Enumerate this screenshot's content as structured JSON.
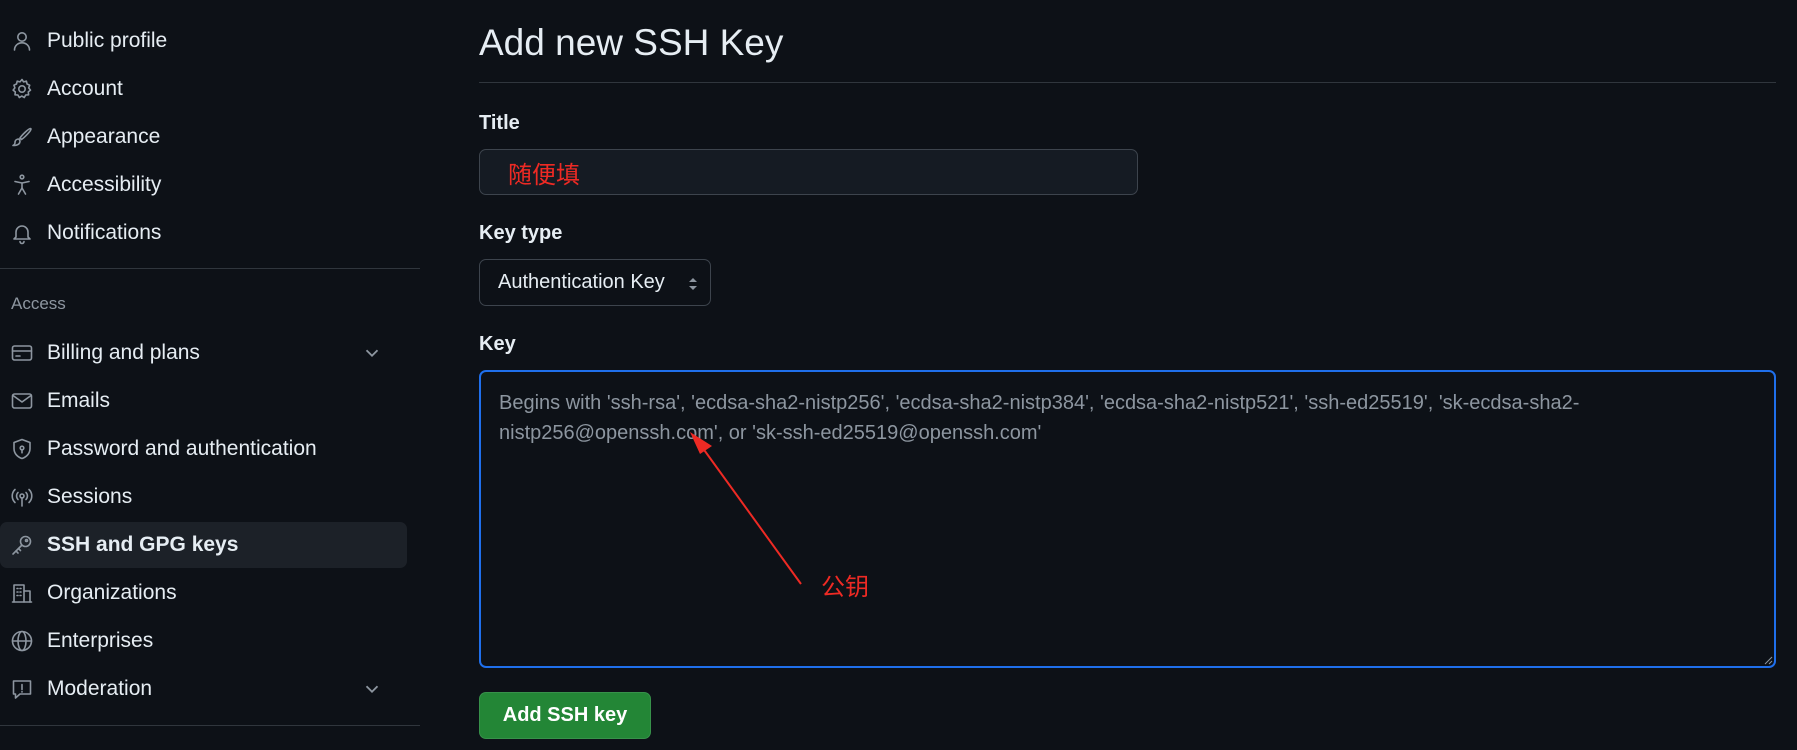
{
  "sidebar": {
    "items": [
      {
        "label": "Public profile",
        "icon": "person-icon"
      },
      {
        "label": "Account",
        "icon": "gear-icon"
      },
      {
        "label": "Appearance",
        "icon": "paintbrush-icon"
      },
      {
        "label": "Accessibility",
        "icon": "accessibility-icon"
      },
      {
        "label": "Notifications",
        "icon": "bell-icon"
      }
    ],
    "access_heading": "Access",
    "access_items": [
      {
        "label": "Billing and plans",
        "icon": "credit-card-icon",
        "expandable": true
      },
      {
        "label": "Emails",
        "icon": "mail-icon"
      },
      {
        "label": "Password and authentication",
        "icon": "shield-lock-icon"
      },
      {
        "label": "Sessions",
        "icon": "broadcast-icon"
      },
      {
        "label": "SSH and GPG keys",
        "icon": "key-icon",
        "active": true
      },
      {
        "label": "Organizations",
        "icon": "organization-icon"
      },
      {
        "label": "Enterprises",
        "icon": "globe-icon"
      },
      {
        "label": "Moderation",
        "icon": "report-icon",
        "expandable": true
      }
    ]
  },
  "main": {
    "title": "Add new SSH Key",
    "title_field": {
      "label": "Title",
      "value": "随便填"
    },
    "key_type_field": {
      "label": "Key type",
      "selected": "Authentication Key"
    },
    "key_field": {
      "label": "Key",
      "placeholder": "Begins with 'ssh-rsa', 'ecdsa-sha2-nistp256', 'ecdsa-sha2-nistp384', 'ecdsa-sha2-nistp521', 'ssh-ed25519', 'sk-ecdsa-sha2-nistp256@openssh.com', or 'sk-ssh-ed25519@openssh.com'"
    },
    "submit_label": "Add SSH key"
  },
  "annotation": {
    "label": "公钥",
    "color": "#ee2a24"
  },
  "colors": {
    "background": "#0d1117",
    "focus_border": "#1f6feb",
    "primary_button": "#238636",
    "active_nav": "#1c2128"
  }
}
